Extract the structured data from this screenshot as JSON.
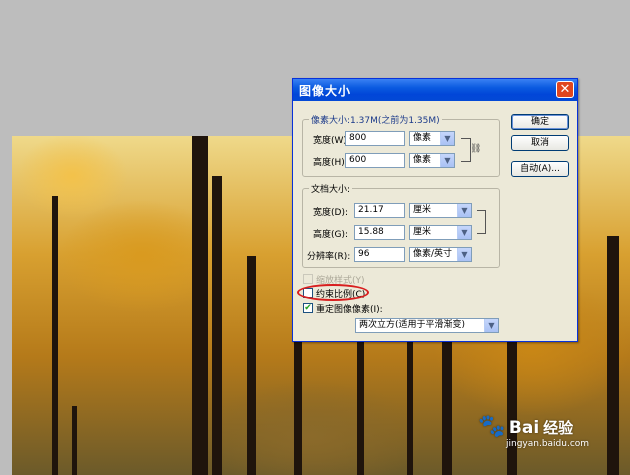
{
  "dialog": {
    "title": "图像大小",
    "ok_label": "确定",
    "cancel_label": "取消",
    "auto_label": "自动(A)...",
    "pixel_dimensions": {
      "label": "像素大小:1.37M(之前为1.35M)",
      "width_label": "宽度(W):",
      "width_value": "800",
      "width_unit": "像素",
      "height_label": "高度(H):",
      "height_value": "600",
      "height_unit": "像素"
    },
    "document_size": {
      "label": "文档大小:",
      "width_label": "宽度(D):",
      "width_value": "21.17",
      "width_unit": "厘米",
      "height_label": "高度(G):",
      "height_value": "15.88",
      "height_unit": "厘米",
      "resolution_label": "分辨率(R):",
      "resolution_value": "96",
      "resolution_unit": "像素/英寸"
    },
    "scale_styles": {
      "label": "缩放样式(Y)",
      "checked": false,
      "enabled": false
    },
    "constrain_proportions": {
      "label": "约束比例(C)",
      "checked": false
    },
    "resample": {
      "label": "重定图像像素(I):",
      "checked": true,
      "method": "两次立方(适用于平滑渐变)"
    }
  },
  "watermark": {
    "logo_text": "Bai",
    "logo_text2": "经验",
    "url": "jingyan.baidu.com"
  },
  "colors": {
    "title_blue": "#0a5ae0",
    "close_red": "#e0461f",
    "dialog_bg": "#ece9d8",
    "highlight_red": "#d81e1e"
  }
}
